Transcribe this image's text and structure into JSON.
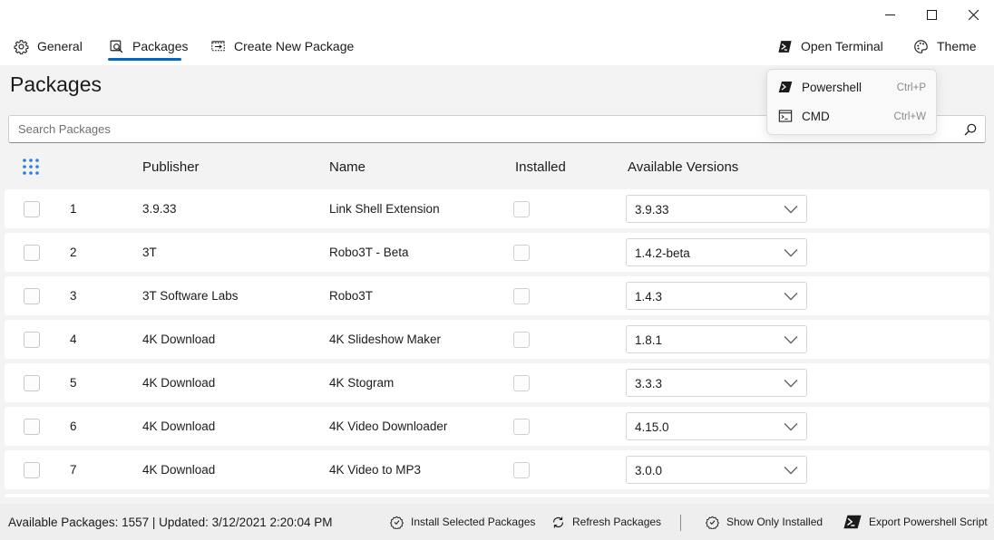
{
  "nav": {
    "general": "General",
    "packages": "Packages",
    "create": "Create New Package",
    "open_terminal": "Open Terminal",
    "theme": "Theme"
  },
  "page": {
    "title": "Packages",
    "search_placeholder": "Search Packages"
  },
  "table": {
    "headers": {
      "publisher": "Publisher",
      "name": "Name",
      "installed": "Installed",
      "versions": "Available Versions"
    },
    "rows": [
      {
        "num": "1",
        "publisher": "3.9.33",
        "name": "Link Shell Extension",
        "version": "3.9.33"
      },
      {
        "num": "2",
        "publisher": "3T",
        "name": "Robo3T - Beta",
        "version": "1.4.2-beta"
      },
      {
        "num": "3",
        "publisher": "3T Software Labs",
        "name": "Robo3T",
        "version": "1.4.3"
      },
      {
        "num": "4",
        "publisher": "4K Download",
        "name": "4K Slideshow Maker",
        "version": "1.8.1"
      },
      {
        "num": "5",
        "publisher": "4K Download",
        "name": "4K Stogram",
        "version": "3.3.3"
      },
      {
        "num": "6",
        "publisher": "4K Download",
        "name": "4K Video Downloader",
        "version": "4.15.0"
      },
      {
        "num": "7",
        "publisher": "4K Download",
        "name": "4K Video to MP3",
        "version": "3.0.0"
      }
    ]
  },
  "status": {
    "text": "Available Packages: 1557 | Updated: 3/12/2021 2:20:04 PM",
    "install": "Install Selected Packages",
    "refresh": "Refresh Packages",
    "show_installed": "Show Only Installed",
    "export": "Export Powershell Script"
  },
  "terminal_menu": {
    "items": [
      {
        "label": "Powershell",
        "shortcut": "Ctrl+P",
        "icon": "powershell-icon"
      },
      {
        "label": "CMD",
        "shortcut": "Ctrl+W",
        "icon": "cmd-icon"
      }
    ]
  },
  "colors": {
    "accent": "#0067c0",
    "grid_icon": "#2b7de1",
    "background": "#f3f3f3"
  }
}
